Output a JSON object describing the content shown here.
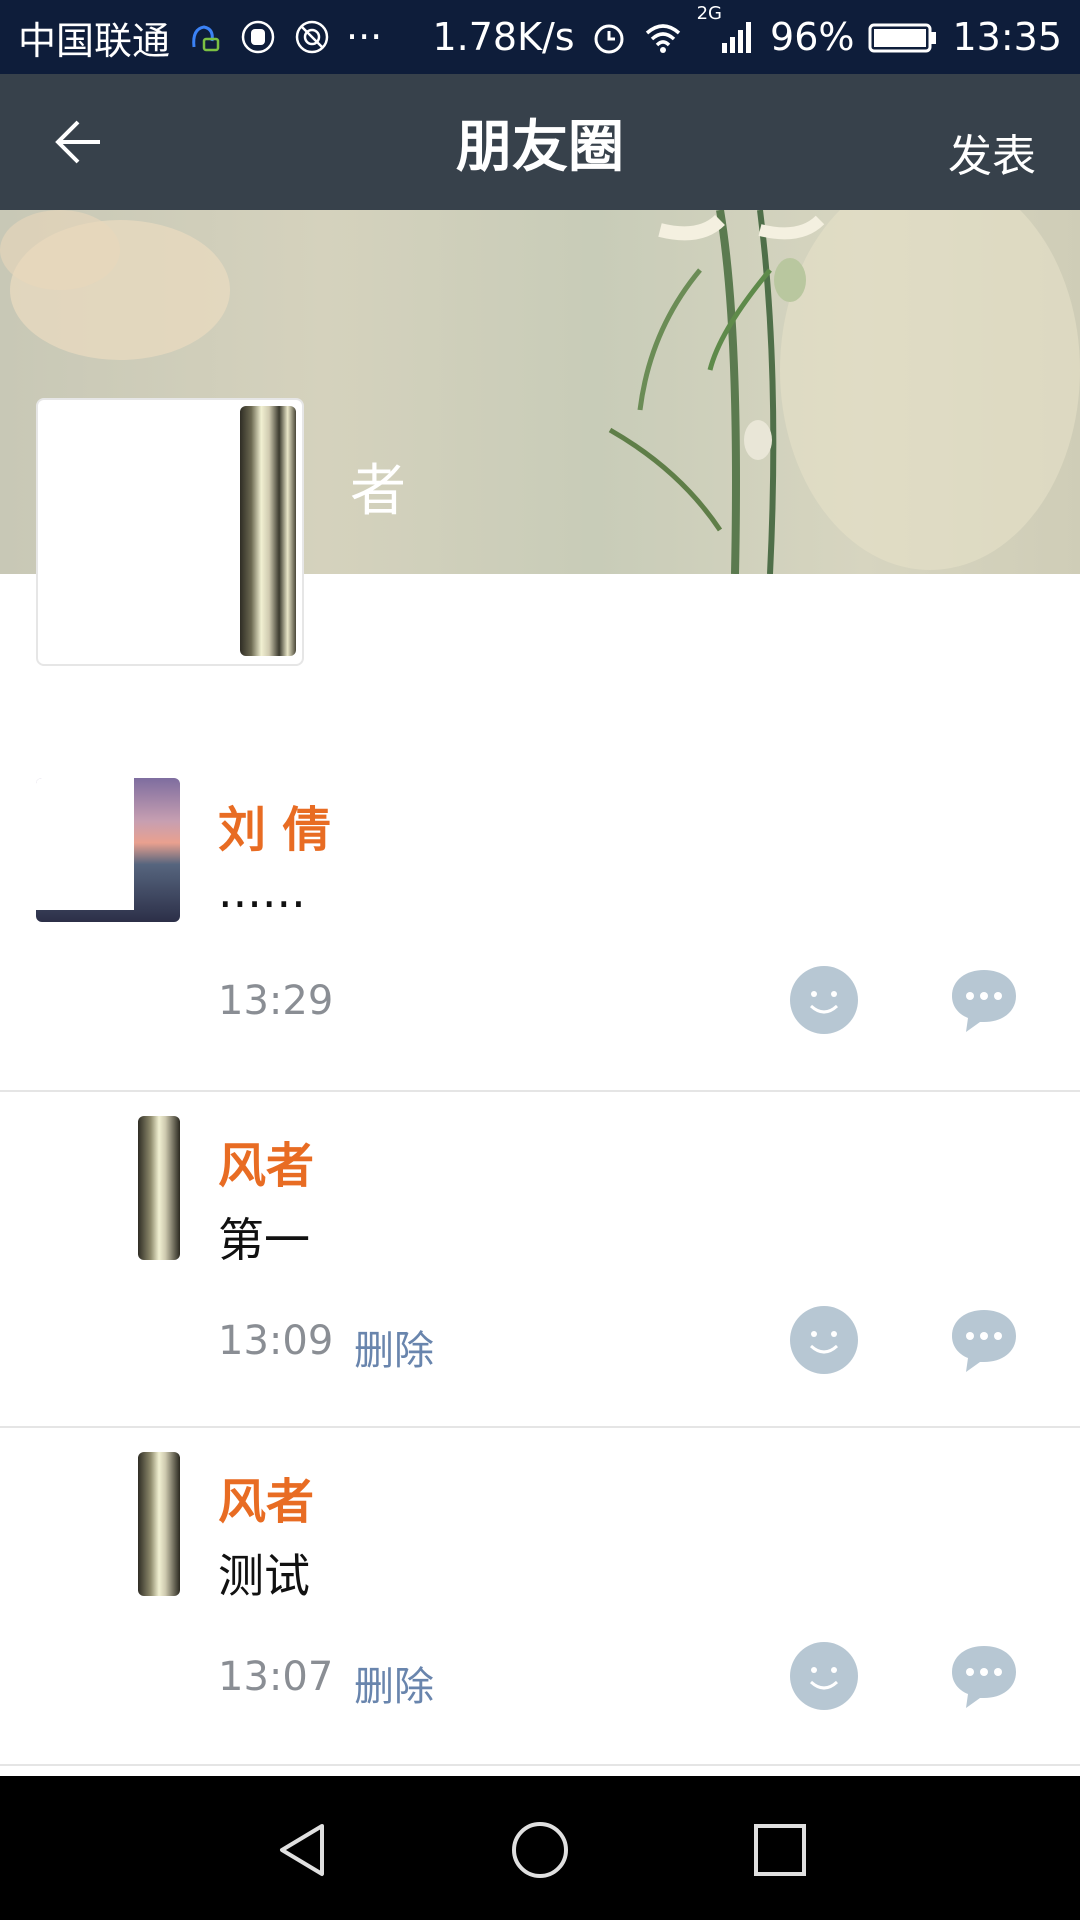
{
  "status_bar": {
    "carrier": "中国联通",
    "more": "···",
    "speed": "1.78K/s",
    "network_type": "2G",
    "battery": "96%",
    "time": "13:35"
  },
  "header": {
    "title": "朋友圈",
    "publish_label": "发表"
  },
  "profile": {
    "name": "者"
  },
  "posts": [
    {
      "name": "刘  倩",
      "content": "......",
      "time": "13:29",
      "delete_label": ""
    },
    {
      "name": "  风者",
      "content": "第一",
      "time": "13:09",
      "delete_label": "删除"
    },
    {
      "name": "  风者",
      "content": "测试",
      "time": "13:07",
      "delete_label": "删除"
    }
  ],
  "colors": {
    "status_bar": "#0e1d3a",
    "header": "#37414b",
    "name": "#e86c23",
    "delete_link": "#6985ad",
    "icon": "#b7c7d3"
  }
}
